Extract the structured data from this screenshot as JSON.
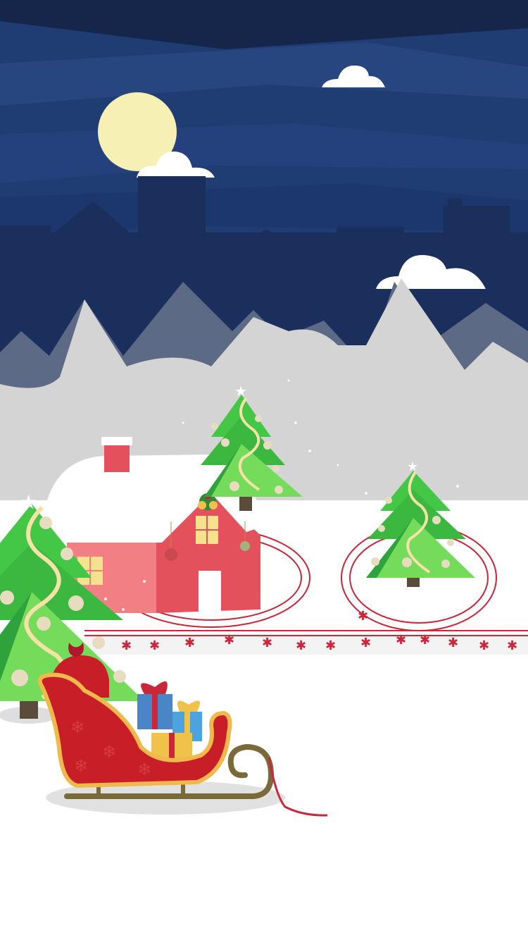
{
  "scene": {
    "description_visible_text": "",
    "palette": {
      "sky_dark": "#16264b",
      "sky_mid": "#1f3c73",
      "sky_light": "#2b4a86",
      "skyline": "#1a2f5c",
      "mountain_back": "#5d6a86",
      "mountain_front": "#d4d4d4",
      "snow": "#ffffff",
      "moon": "#f7f0b4",
      "house_red": "#e3525c",
      "house_pink": "#f27f83",
      "tree_green": "#44c646",
      "tree_green_light": "#74dc5a",
      "tree_green_dark": "#2fa33b",
      "ornament_gold": "#f4e2a6",
      "ribbon_red": "#c8283a",
      "sleigh_red": "#c81e27",
      "sleigh_gold": "#f0b94b",
      "runner_brown": "#7a6a3a"
    },
    "icons": [
      "moon-icon",
      "cloud-icon",
      "house-icon",
      "christmas-tree-icon",
      "sleigh-icon",
      "gift-icon",
      "gift-bag-icon",
      "bell-icon",
      "star-icon",
      "snowflake-icon"
    ]
  }
}
